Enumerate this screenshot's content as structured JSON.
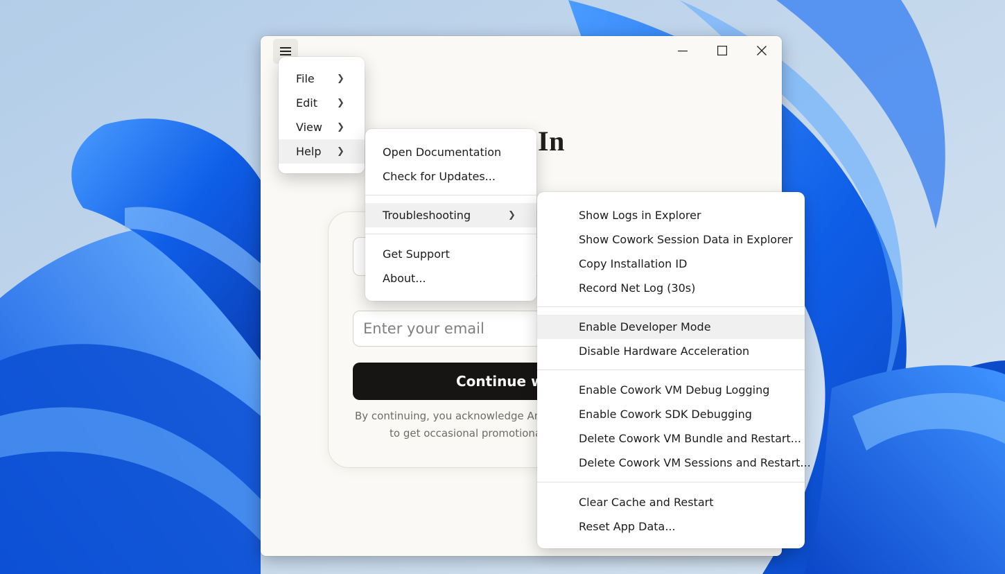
{
  "window": {
    "heading": "In",
    "email_placeholder": "Enter your email",
    "continue_label": "Continue wit",
    "legal_line1": "By continuing, you acknowledge Anth",
    "legal_line2": "to get occasional promotional e",
    "controls": {
      "minimize": "minimize-icon",
      "maximize": "maximize-icon",
      "close": "close-icon"
    }
  },
  "main_menu": {
    "items": [
      {
        "label": "File",
        "submenu": true
      },
      {
        "label": "Edit",
        "submenu": true
      },
      {
        "label": "View",
        "submenu": true
      },
      {
        "label": "Help",
        "submenu": true,
        "highlighted": true
      }
    ]
  },
  "help_menu": {
    "items": [
      {
        "label": "Open Documentation"
      },
      {
        "label": "Check for Updates..."
      },
      {
        "label": "Troubleshooting",
        "submenu": true,
        "highlighted": true
      },
      {
        "label": "Get Support"
      },
      {
        "label": "About..."
      }
    ]
  },
  "troubleshooting_menu": {
    "items": [
      {
        "label": "Show Logs in Explorer"
      },
      {
        "label": "Show Cowork Session Data in Explorer"
      },
      {
        "label": "Copy Installation ID"
      },
      {
        "label": "Record Net Log (30s)"
      },
      {
        "label": "Enable Developer Mode",
        "highlighted": true
      },
      {
        "label": "Disable Hardware Acceleration"
      },
      {
        "label": "Enable Cowork VM Debug Logging"
      },
      {
        "label": "Enable Cowork SDK Debugging"
      },
      {
        "label": "Delete Cowork VM Bundle and Restart..."
      },
      {
        "label": "Delete Cowork VM Sessions and Restart..."
      },
      {
        "label": "Clear Cache and Restart"
      },
      {
        "label": "Reset App Data..."
      }
    ]
  },
  "colors": {
    "accent_dark": "#161513",
    "wallpaper_blue": "#1e6cf0"
  }
}
